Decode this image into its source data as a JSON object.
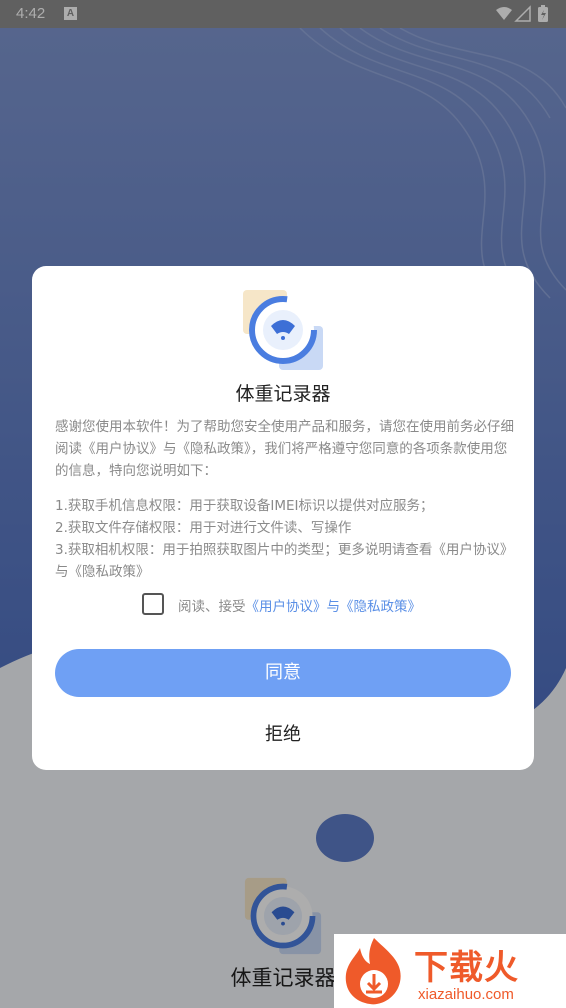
{
  "status_bar": {
    "time": "4:42",
    "badge": "A"
  },
  "dialog": {
    "app_name": "体重记录器",
    "intro": "感谢您使用本软件！为了帮助您安全使用产品和服务，请您在使用前务必仔细阅读《用户协议》与《隐私政策》，我们将严格遵守您同意的各项条款使用您的信息，特向您说明如下：",
    "permissions": [
      "1.获取手机信息权限：用于获取设备IMEI标识以提供对应服务；",
      "2.获取文件存储权限：用于对进行文件读、写操作",
      "3.获取相机权限：用于拍照获取图片中的类型；更多说明请查看《用户协议》与《隐私政策》"
    ],
    "agree_prefix": "阅读、接受",
    "agree_links": "《用户协议》与《隐私政策》",
    "agree_checked": false,
    "agree_button": "同意",
    "reject_button": "拒绝"
  },
  "background": {
    "app_name": "体重记录器"
  },
  "watermark": {
    "text": "下载火",
    "url": "xiazaihuo.com"
  },
  "colors": {
    "accent": "#6fa0f4",
    "link": "#5a8fe6",
    "wave_blue": "#5d7cc7"
  },
  "icons": {
    "wifi": "wifi-icon",
    "signal": "signal-icon",
    "battery": "battery-icon",
    "scale": "scale-icon"
  }
}
